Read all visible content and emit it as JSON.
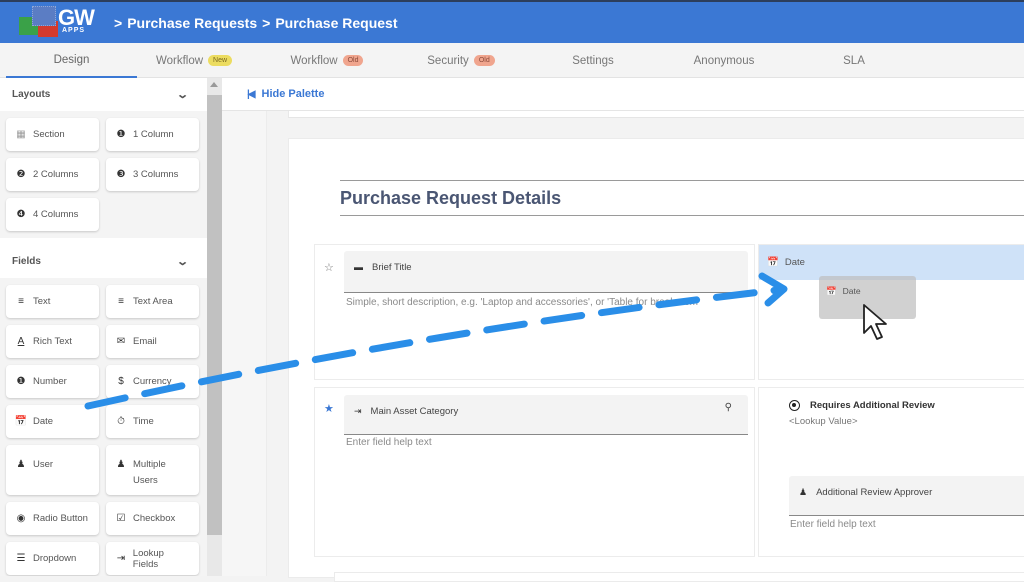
{
  "header": {
    "logo_text": "GW",
    "logo_subtext": "APPS",
    "breadcrumb": [
      {
        "label": "Purchase Requests"
      },
      {
        "label": "Purchase Request"
      }
    ],
    "breadcrumb_separator": ">"
  },
  "tabs": [
    {
      "label": "Design",
      "active": true,
      "badge": null
    },
    {
      "label": "Workflow",
      "badge": "New"
    },
    {
      "label": "Workflow",
      "badge": "Old"
    },
    {
      "label": "Security",
      "badge": "Old"
    },
    {
      "label": "Settings",
      "badge": null
    },
    {
      "label": "Anonymous",
      "badge": null
    },
    {
      "label": "SLA",
      "badge": null
    }
  ],
  "palette": {
    "layouts_title": "Layouts",
    "layouts": [
      {
        "label": "Section",
        "icon": "section-dotted-grid-icon"
      },
      {
        "label": "1 Column",
        "icon": "one-column-icon"
      },
      {
        "label": "2 Columns",
        "icon": "two-columns-icon"
      },
      {
        "label": "3 Columns",
        "icon": "three-columns-icon"
      },
      {
        "label": "4 Columns",
        "icon": "four-columns-icon"
      }
    ],
    "fields_title": "Fields",
    "fields": [
      {
        "label": "Text",
        "icon": "short-text-icon"
      },
      {
        "label": "Text Area",
        "icon": "wrap-text-icon"
      },
      {
        "label": "Rich Text",
        "icon": "text-format-icon"
      },
      {
        "label": "Email",
        "icon": "envelope-icon"
      },
      {
        "label": "Number",
        "icon": "number-box-icon"
      },
      {
        "label": "Currency",
        "icon": "dollar-icon"
      },
      {
        "label": "Date",
        "icon": "calendar-icon"
      },
      {
        "label": "Time",
        "icon": "stopwatch-icon"
      },
      {
        "label": "User",
        "icon": "person-icon"
      },
      {
        "label": "Multiple Users",
        "icon": "people-icon"
      },
      {
        "label": "Radio Button",
        "icon": "radio-button-icon"
      },
      {
        "label": "Checkbox",
        "icon": "checkbox-icon"
      },
      {
        "label": "Dropdown",
        "icon": "list-icon"
      },
      {
        "label": "Lookup Fields",
        "icon": "input-arrow-icon"
      }
    ]
  },
  "canvas": {
    "hide_palette_label": "Hide Palette",
    "section_title": "Purchase Request Details",
    "cells": {
      "brief_title": {
        "label": "Brief Title",
        "help": "Simple, short description, e.g. 'Laptop and accessories', or 'Table for breakroom'",
        "required": false
      },
      "date_drop_target": {
        "label": "Date",
        "drag_ghost_label": "Date"
      },
      "main_asset_category": {
        "label": "Main Asset Category",
        "help": "Enter field help text",
        "required": true
      },
      "requires_review": {
        "label": "Requires Additional Review",
        "value": "<Lookup Value>"
      },
      "review_approver": {
        "label": "Additional Review Approver",
        "help": "Enter field help text"
      }
    }
  },
  "colors": {
    "brand": "#3b78d4",
    "drop_highlight": "#cfe2f8",
    "arrow": "#2a8ee8",
    "badge_new": "#ecdc60",
    "badge_old": "#f0a58e",
    "section_title": "#4a5673"
  }
}
